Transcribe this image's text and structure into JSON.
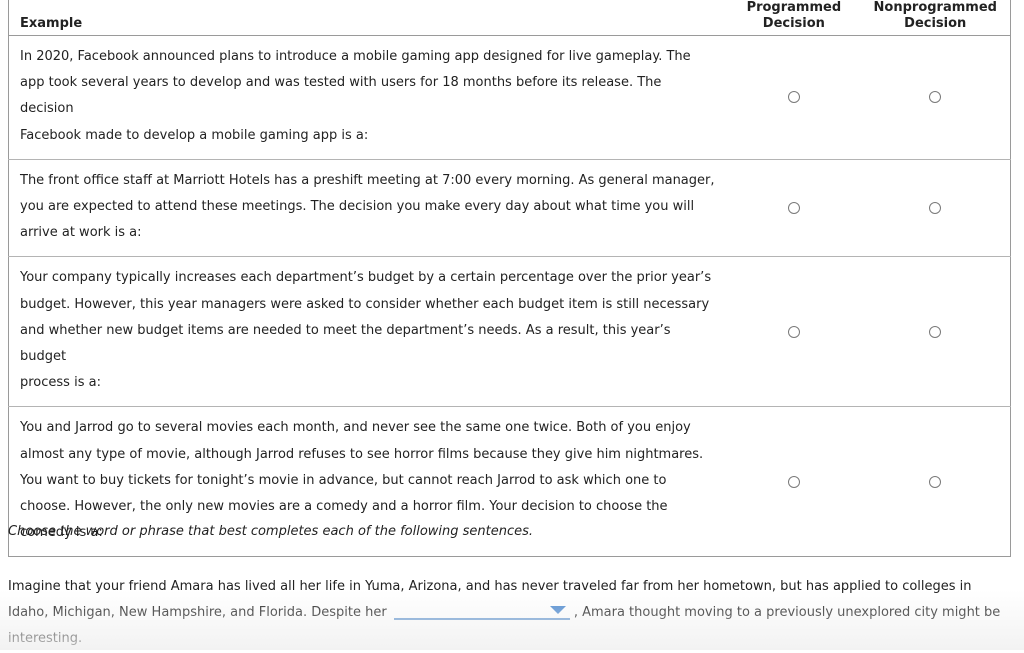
{
  "table": {
    "headers": {
      "example": "Example",
      "programmed_line1": "Programmed",
      "programmed_line2": "Decision",
      "nonprogrammed_line1": "Nonprogrammed",
      "nonprogrammed_line2": "Decision"
    },
    "rows": [
      {
        "lines": [
          "In 2020, Facebook announced plans to introduce a mobile gaming app designed for live gameplay. The",
          "app took several years to develop and was tested with users for 18 months before its release. The decision",
          "Facebook made to develop a mobile gaming app is a:"
        ],
        "programmed_selected": false,
        "nonprogrammed_selected": false
      },
      {
        "lines": [
          "The front office staff at Marriott Hotels has a preshift meeting at 7:00 every morning. As general manager,",
          "you are expected to attend these meetings. The decision you make every day about what time you will",
          "arrive at work is a:"
        ],
        "programmed_selected": false,
        "nonprogrammed_selected": false
      },
      {
        "lines": [
          "Your company typically increases each department’s budget by a certain percentage over the prior year’s",
          "budget. However, this year managers were asked to consider whether each budget item is still necessary",
          "and whether new budget items are needed to meet the department’s needs. As a result, this year’s budget",
          "process is a:"
        ],
        "programmed_selected": false,
        "nonprogrammed_selected": false
      },
      {
        "lines": [
          "You and Jarrod go to several movies each month, and never see the same one twice. Both of you enjoy",
          "almost any type of movie, although Jarrod refuses to see horror films because they give him nightmares.",
          "You want to buy tickets for tonight’s movie in advance, but cannot reach Jarrod to ask which one to",
          "choose. However, the only new movies are a comedy and a horror film. Your decision to choose the",
          "comedy is a:"
        ],
        "programmed_selected": false,
        "nonprogrammed_selected": false
      }
    ]
  },
  "instruction": "Choose the word or phrase that best completes each of the following sentences.",
  "fill_in": {
    "before": "Imagine that your friend Amara has lived all her life in Yuma, Arizona, and has never traveled far from her hometown, but has applied to colleges in Idaho, Michigan, New Hampshire, and Florida. Despite her",
    "dropdown_value": "",
    "after": ", Amara thought moving to a previously unexplored city might be interesting."
  },
  "colors": {
    "dropdown_accent": "#4e8ad0",
    "border": "#9a9a9a",
    "text": "#222222"
  }
}
